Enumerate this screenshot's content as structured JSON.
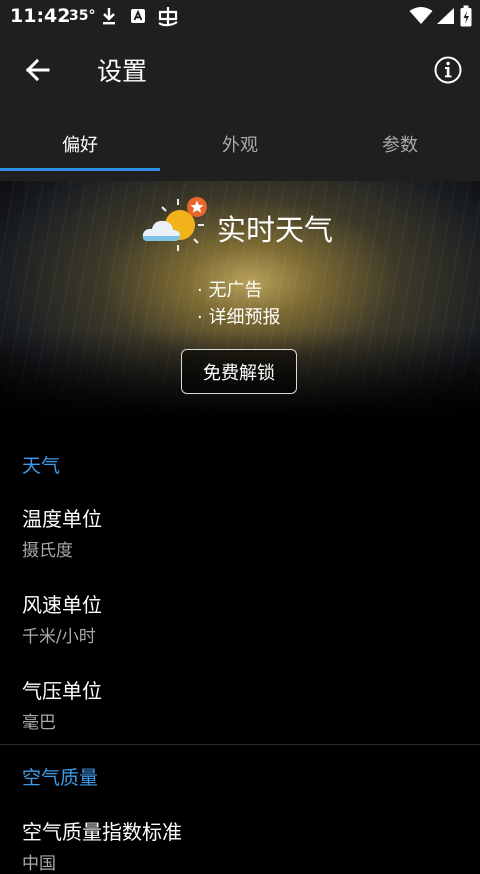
{
  "status_bar": {
    "time": "11:42",
    "temperature": "35°"
  },
  "app_bar": {
    "title": "设置"
  },
  "tabs": [
    {
      "label": "偏好",
      "active": true
    },
    {
      "label": "外观",
      "active": false
    },
    {
      "label": "参数",
      "active": false
    }
  ],
  "promo": {
    "title": "实时天气",
    "features": [
      "无广告",
      "详细预报"
    ],
    "unlock_label": "免费解锁"
  },
  "sections": {
    "weather": {
      "header": "天气",
      "prefs": [
        {
          "title": "温度单位",
          "summary": "摄氏度"
        },
        {
          "title": "风速单位",
          "summary": "千米/小时"
        },
        {
          "title": "气压单位",
          "summary": "毫巴"
        }
      ]
    },
    "air_quality": {
      "header": "空气质量",
      "prefs": [
        {
          "title": "空气质量指数标准",
          "summary": "中国"
        }
      ]
    }
  },
  "colors": {
    "accent": "#2f8de4",
    "section_header": "#3d9be9",
    "bar_background": "#1f1f1f"
  },
  "icons": [
    "download-icon",
    "text-icon",
    "app-icon",
    "wifi-icon",
    "signal-icon",
    "battery-icon",
    "back-arrow-icon",
    "info-icon",
    "weather-logo-icon"
  ]
}
